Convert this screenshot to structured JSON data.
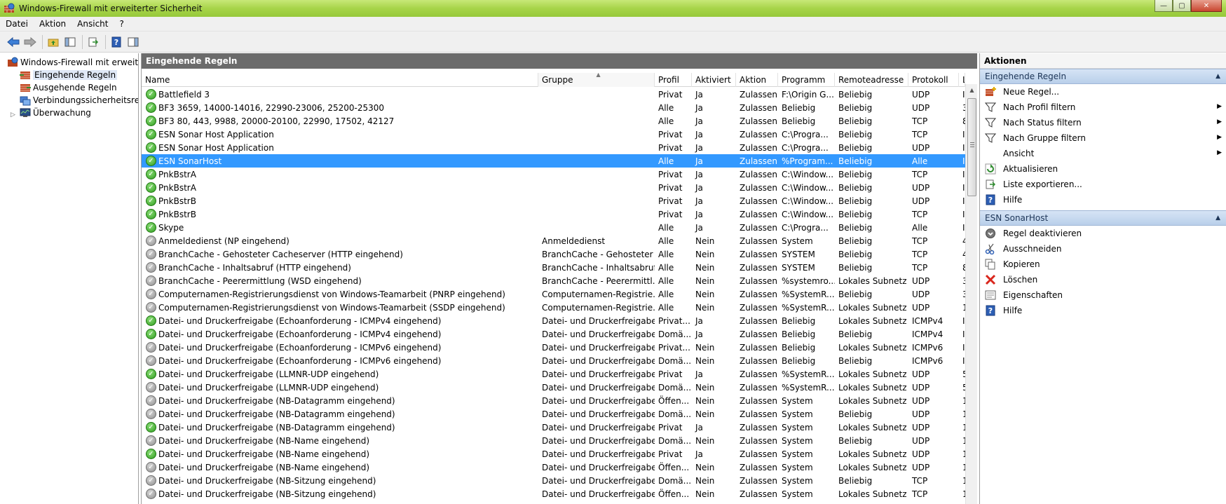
{
  "window": {
    "title": "Windows-Firewall mit erweiterter Sicherheit"
  },
  "menu": [
    "Datei",
    "Aktion",
    "Ansicht",
    "?"
  ],
  "tree": {
    "root": "Windows-Firewall mit erweitert",
    "items": [
      "Eingehende Regeln",
      "Ausgehende Regeln",
      "Verbindungssicherheitsrege",
      "Überwachung"
    ]
  },
  "center": {
    "title": "Eingehende Regeln",
    "columns": [
      "Name",
      "Gruppe",
      "Profil",
      "Aktiviert",
      "Aktion",
      "Programm",
      "Remoteadresse",
      "Protokoll",
      "L"
    ],
    "rows": [
      {
        "on": true,
        "name": "Battlefield 3",
        "group": "",
        "profile": "Privat",
        "enabled": "Ja",
        "action": "Zulassen",
        "program": "F:\\Origin G...",
        "remote": "Beliebig",
        "protocol": "UDP",
        "last": "I"
      },
      {
        "on": true,
        "name": "BF3 3659, 14000-14016, 22990-23006, 25200-25300",
        "group": "",
        "profile": "Alle",
        "enabled": "Ja",
        "action": "Zulassen",
        "program": "Beliebig",
        "remote": "Beliebig",
        "protocol": "UDP",
        "last": "3"
      },
      {
        "on": true,
        "name": "BF3 80, 443, 9988, 20000-20100, 22990, 17502, 42127",
        "group": "",
        "profile": "Alle",
        "enabled": "Ja",
        "action": "Zulassen",
        "program": "Beliebig",
        "remote": "Beliebig",
        "protocol": "TCP",
        "last": "8"
      },
      {
        "on": true,
        "name": "ESN Sonar Host Application",
        "group": "",
        "profile": "Privat",
        "enabled": "Ja",
        "action": "Zulassen",
        "program": "C:\\Progra...",
        "remote": "Beliebig",
        "protocol": "TCP",
        "last": "I"
      },
      {
        "on": true,
        "name": "ESN Sonar Host Application",
        "group": "",
        "profile": "Privat",
        "enabled": "Ja",
        "action": "Zulassen",
        "program": "C:\\Progra...",
        "remote": "Beliebig",
        "protocol": "UDP",
        "last": "I"
      },
      {
        "on": true,
        "name": "ESN SonarHost",
        "group": "",
        "profile": "Alle",
        "enabled": "Ja",
        "action": "Zulassen",
        "program": "%Program...",
        "remote": "Beliebig",
        "protocol": "Alle",
        "last": "I",
        "selected": true
      },
      {
        "on": true,
        "name": "PnkBstrA",
        "group": "",
        "profile": "Privat",
        "enabled": "Ja",
        "action": "Zulassen",
        "program": "C:\\Window...",
        "remote": "Beliebig",
        "protocol": "TCP",
        "last": "I"
      },
      {
        "on": true,
        "name": "PnkBstrA",
        "group": "",
        "profile": "Privat",
        "enabled": "Ja",
        "action": "Zulassen",
        "program": "C:\\Window...",
        "remote": "Beliebig",
        "protocol": "UDP",
        "last": "I"
      },
      {
        "on": true,
        "name": "PnkBstrB",
        "group": "",
        "profile": "Privat",
        "enabled": "Ja",
        "action": "Zulassen",
        "program": "C:\\Window...",
        "remote": "Beliebig",
        "protocol": "UDP",
        "last": "I"
      },
      {
        "on": true,
        "name": "PnkBstrB",
        "group": "",
        "profile": "Privat",
        "enabled": "Ja",
        "action": "Zulassen",
        "program": "C:\\Window...",
        "remote": "Beliebig",
        "protocol": "TCP",
        "last": "I"
      },
      {
        "on": true,
        "name": "Skype",
        "group": "",
        "profile": "Alle",
        "enabled": "Ja",
        "action": "Zulassen",
        "program": "C:\\Progra...",
        "remote": "Beliebig",
        "protocol": "Alle",
        "last": "I"
      },
      {
        "on": false,
        "name": "Anmeldedienst (NP eingehend)",
        "group": "Anmeldedienst",
        "profile": "Alle",
        "enabled": "Nein",
        "action": "Zulassen",
        "program": "System",
        "remote": "Beliebig",
        "protocol": "TCP",
        "last": "4"
      },
      {
        "on": false,
        "name": "BranchCache - Gehosteter Cacheserver (HTTP eingehend)",
        "group": "BranchCache - Gehosteter ...",
        "profile": "Alle",
        "enabled": "Nein",
        "action": "Zulassen",
        "program": "SYSTEM",
        "remote": "Beliebig",
        "protocol": "TCP",
        "last": "4"
      },
      {
        "on": false,
        "name": "BranchCache - Inhaltsabruf (HTTP eingehend)",
        "group": "BranchCache - Inhaltsabruf ...",
        "profile": "Alle",
        "enabled": "Nein",
        "action": "Zulassen",
        "program": "SYSTEM",
        "remote": "Beliebig",
        "protocol": "TCP",
        "last": "8"
      },
      {
        "on": false,
        "name": "BranchCache - Peerermittlung (WSD eingehend)",
        "group": "BranchCache - Peerermittl...",
        "profile": "Alle",
        "enabled": "Nein",
        "action": "Zulassen",
        "program": "%systemro...",
        "remote": "Lokales Subnetz",
        "protocol": "UDP",
        "last": "3"
      },
      {
        "on": false,
        "name": "Computernamen-Registrierungsdienst von Windows-Teamarbeit (PNRP eingehend)",
        "group": "Computernamen-Registrie...",
        "profile": "Alle",
        "enabled": "Nein",
        "action": "Zulassen",
        "program": "%SystemR...",
        "remote": "Beliebig",
        "protocol": "UDP",
        "last": "3"
      },
      {
        "on": false,
        "name": "Computernamen-Registrierungsdienst von Windows-Teamarbeit (SSDP eingehend)",
        "group": "Computernamen-Registrie...",
        "profile": "Alle",
        "enabled": "Nein",
        "action": "Zulassen",
        "program": "%SystemR...",
        "remote": "Lokales Subnetz",
        "protocol": "UDP",
        "last": "1"
      },
      {
        "on": true,
        "name": "Datei- und Druckerfreigabe (Echoanforderung - ICMPv4 eingehend)",
        "group": "Datei- und Druckerfreigabe",
        "profile": "Privat...",
        "enabled": "Ja",
        "action": "Zulassen",
        "program": "Beliebig",
        "remote": "Lokales Subnetz",
        "protocol": "ICMPv4",
        "last": "I"
      },
      {
        "on": true,
        "name": "Datei- und Druckerfreigabe (Echoanforderung - ICMPv4 eingehend)",
        "group": "Datei- und Druckerfreigabe",
        "profile": "Domä...",
        "enabled": "Ja",
        "action": "Zulassen",
        "program": "Beliebig",
        "remote": "Beliebig",
        "protocol": "ICMPv4",
        "last": "I"
      },
      {
        "on": false,
        "name": "Datei- und Druckerfreigabe (Echoanforderung - ICMPv6 eingehend)",
        "group": "Datei- und Druckerfreigabe",
        "profile": "Privat...",
        "enabled": "Nein",
        "action": "Zulassen",
        "program": "Beliebig",
        "remote": "Lokales Subnetz",
        "protocol": "ICMPv6",
        "last": "I"
      },
      {
        "on": false,
        "name": "Datei- und Druckerfreigabe (Echoanforderung - ICMPv6 eingehend)",
        "group": "Datei- und Druckerfreigabe",
        "profile": "Domä...",
        "enabled": "Nein",
        "action": "Zulassen",
        "program": "Beliebig",
        "remote": "Beliebig",
        "protocol": "ICMPv6",
        "last": "I"
      },
      {
        "on": true,
        "name": "Datei- und Druckerfreigabe (LLMNR-UDP eingehend)",
        "group": "Datei- und Druckerfreigabe",
        "profile": "Privat",
        "enabled": "Ja",
        "action": "Zulassen",
        "program": "%SystemR...",
        "remote": "Lokales Subnetz",
        "protocol": "UDP",
        "last": "5"
      },
      {
        "on": false,
        "name": "Datei- und Druckerfreigabe (LLMNR-UDP eingehend)",
        "group": "Datei- und Druckerfreigabe",
        "profile": "Domä...",
        "enabled": "Nein",
        "action": "Zulassen",
        "program": "%SystemR...",
        "remote": "Lokales Subnetz",
        "protocol": "UDP",
        "last": "5"
      },
      {
        "on": false,
        "name": "Datei- und Druckerfreigabe (NB-Datagramm eingehend)",
        "group": "Datei- und Druckerfreigabe",
        "profile": "Öffen...",
        "enabled": "Nein",
        "action": "Zulassen",
        "program": "System",
        "remote": "Lokales Subnetz",
        "protocol": "UDP",
        "last": "1"
      },
      {
        "on": false,
        "name": "Datei- und Druckerfreigabe (NB-Datagramm eingehend)",
        "group": "Datei- und Druckerfreigabe",
        "profile": "Domä...",
        "enabled": "Nein",
        "action": "Zulassen",
        "program": "System",
        "remote": "Beliebig",
        "protocol": "UDP",
        "last": "1"
      },
      {
        "on": true,
        "name": "Datei- und Druckerfreigabe (NB-Datagramm eingehend)",
        "group": "Datei- und Druckerfreigabe",
        "profile": "Privat",
        "enabled": "Ja",
        "action": "Zulassen",
        "program": "System",
        "remote": "Lokales Subnetz",
        "protocol": "UDP",
        "last": "1"
      },
      {
        "on": false,
        "name": "Datei- und Druckerfreigabe (NB-Name eingehend)",
        "group": "Datei- und Druckerfreigabe",
        "profile": "Domä...",
        "enabled": "Nein",
        "action": "Zulassen",
        "program": "System",
        "remote": "Beliebig",
        "protocol": "UDP",
        "last": "1"
      },
      {
        "on": true,
        "name": "Datei- und Druckerfreigabe (NB-Name eingehend)",
        "group": "Datei- und Druckerfreigabe",
        "profile": "Privat",
        "enabled": "Ja",
        "action": "Zulassen",
        "program": "System",
        "remote": "Lokales Subnetz",
        "protocol": "UDP",
        "last": "1"
      },
      {
        "on": false,
        "name": "Datei- und Druckerfreigabe (NB-Name eingehend)",
        "group": "Datei- und Druckerfreigabe",
        "profile": "Öffen...",
        "enabled": "Nein",
        "action": "Zulassen",
        "program": "System",
        "remote": "Lokales Subnetz",
        "protocol": "UDP",
        "last": "1"
      },
      {
        "on": false,
        "name": "Datei- und Druckerfreigabe (NB-Sitzung eingehend)",
        "group": "Datei- und Druckerfreigabe",
        "profile": "Domä...",
        "enabled": "Nein",
        "action": "Zulassen",
        "program": "System",
        "remote": "Beliebig",
        "protocol": "TCP",
        "last": "1"
      },
      {
        "on": false,
        "name": "Datei- und Druckerfreigabe (NB-Sitzung eingehend)",
        "group": "Datei- und Druckerfreigabe",
        "profile": "Öffen...",
        "enabled": "Nein",
        "action": "Zulassen",
        "program": "System",
        "remote": "Lokales Subnetz",
        "protocol": "TCP",
        "last": "1"
      }
    ]
  },
  "actions": {
    "title": "Aktionen",
    "section1": {
      "title": "Eingehende Regeln",
      "items": [
        {
          "label": "Neue Regel...",
          "icon": "new-rule-icon",
          "submenu": false
        },
        {
          "label": "Nach Profil filtern",
          "icon": "filter-icon",
          "submenu": true
        },
        {
          "label": "Nach Status filtern",
          "icon": "filter-icon",
          "submenu": true
        },
        {
          "label": "Nach Gruppe filtern",
          "icon": "filter-icon",
          "submenu": true
        },
        {
          "label": "Ansicht",
          "icon": "",
          "submenu": true
        },
        {
          "label": "Aktualisieren",
          "icon": "refresh-icon",
          "submenu": false
        },
        {
          "label": "Liste exportieren...",
          "icon": "export-icon",
          "submenu": false
        },
        {
          "label": "Hilfe",
          "icon": "help-icon",
          "submenu": false
        }
      ]
    },
    "section2": {
      "title": "ESN SonarHost",
      "items": [
        {
          "label": "Regel deaktivieren",
          "icon": "disable-icon"
        },
        {
          "label": "Ausschneiden",
          "icon": "cut-icon"
        },
        {
          "label": "Kopieren",
          "icon": "copy-icon"
        },
        {
          "label": "Löschen",
          "icon": "delete-icon"
        },
        {
          "label": "Eigenschaften",
          "icon": "properties-icon"
        },
        {
          "label": "Hilfe",
          "icon": "help-icon"
        }
      ]
    }
  }
}
